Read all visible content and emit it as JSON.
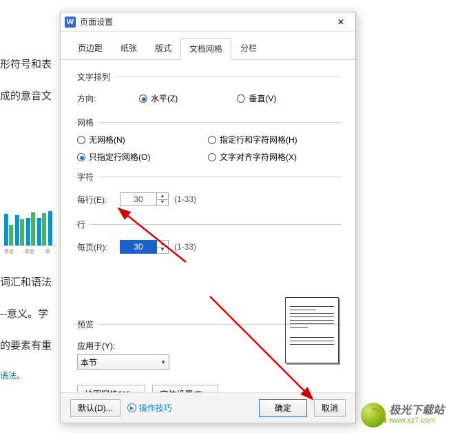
{
  "background": {
    "line1": "形符号和表",
    "line2": "成的意音文",
    "line3": "词汇和语法",
    "line4": "--意义。学",
    "line5": "的要素有重",
    "line6": "语法",
    "dot": "。"
  },
  "dialog": {
    "title": "页面设置",
    "tabs": [
      "页边距",
      "纸张",
      "版式",
      "文档网格",
      "分栏"
    ],
    "active_tab": 3,
    "orientation": {
      "legend": "文字排列",
      "label": "方向:",
      "options": [
        {
          "label": "水平(Z)",
          "checked": true
        },
        {
          "label": "垂直(V)",
          "checked": false
        }
      ]
    },
    "grid": {
      "legend": "网格",
      "options": [
        {
          "label": "无网格(N)",
          "checked": false
        },
        {
          "label": "指定行和字符网格(H)",
          "checked": false
        },
        {
          "label": "只指定行网格(O)",
          "checked": true
        },
        {
          "label": "文字对齐字符网格(X)",
          "checked": false
        }
      ]
    },
    "chars": {
      "legend": "字符",
      "label": "每行(E):",
      "value": "30",
      "range": "(1-33)"
    },
    "lines": {
      "legend": "行",
      "label": "每页(R):",
      "value": "30",
      "range": "(1-33)"
    },
    "preview": {
      "legend": "预览",
      "apply_label": "应用于(Y):",
      "apply_value": "本节"
    },
    "buttons": {
      "draw_grid": "绘图网格(W)...",
      "font_settings": "字体设置(F)...",
      "default": "默认(D)...",
      "tips": "操作技巧",
      "ok": "确定",
      "cancel": "取消"
    }
  },
  "brand": {
    "cn": "极光下载站",
    "en": "www.xz7.com"
  }
}
